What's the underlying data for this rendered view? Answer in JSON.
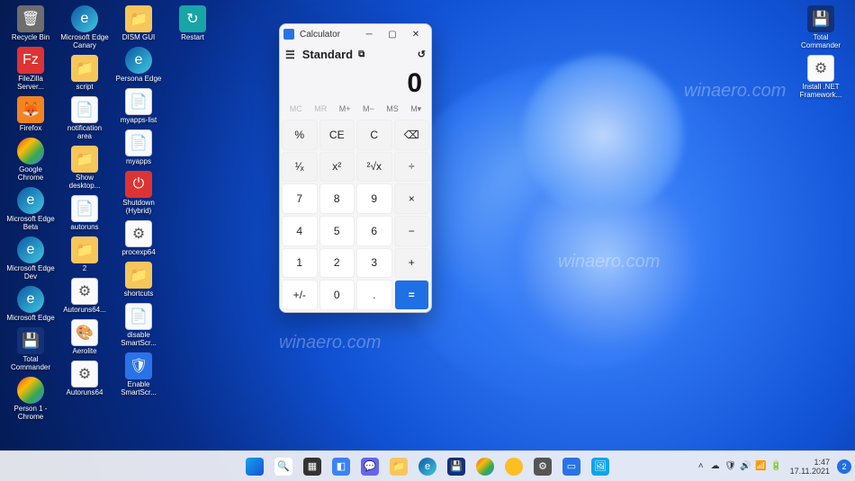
{
  "desktop_icons_left": [
    {
      "label": "Recycle Bin",
      "cls": "bin",
      "glyph": "🗑"
    },
    {
      "label": "FileZilla Server...",
      "cls": "red",
      "glyph": "Fz"
    },
    {
      "label": "Firefox",
      "cls": "orange",
      "glyph": "🦊"
    },
    {
      "label": "Google Chrome",
      "cls": "chrome",
      "glyph": ""
    },
    {
      "label": "Microsoft Edge Beta",
      "cls": "edge",
      "glyph": "e"
    },
    {
      "label": "Microsoft Edge Dev",
      "cls": "edge",
      "glyph": "e"
    },
    {
      "label": "Microsoft Edge",
      "cls": "edge",
      "glyph": "e"
    },
    {
      "label": "Total Commander",
      "cls": "navy",
      "glyph": "💾"
    },
    {
      "label": "Person 1 - Chrome",
      "cls": "chrome",
      "glyph": ""
    },
    {
      "label": "Microsoft Edge Canary",
      "cls": "edge",
      "glyph": "e"
    },
    {
      "label": "script",
      "cls": "folder",
      "glyph": "📁"
    },
    {
      "label": "notification area",
      "cls": "file",
      "glyph": "📄"
    },
    {
      "label": "Show desktop...",
      "cls": "folder",
      "glyph": "📁"
    },
    {
      "label": "autoruns",
      "cls": "file",
      "glyph": "📄"
    },
    {
      "label": "2",
      "cls": "folder",
      "glyph": "📁"
    },
    {
      "label": "Autoruns64...",
      "cls": "file",
      "glyph": "⚙"
    },
    {
      "label": "Aerolite",
      "cls": "file",
      "glyph": "🎨"
    },
    {
      "label": "Autoruns64",
      "cls": "file",
      "glyph": "⚙"
    },
    {
      "label": "DISM GUI",
      "cls": "folder",
      "glyph": "📁"
    },
    {
      "label": "Persona Edge",
      "cls": "edge",
      "glyph": "e"
    },
    {
      "label": "myapps-list",
      "cls": "file",
      "glyph": "📄"
    },
    {
      "label": "myapps",
      "cls": "file",
      "glyph": "📄"
    },
    {
      "label": "Shutdown (Hybrid)",
      "cls": "red",
      "glyph": "⏻"
    },
    {
      "label": "procexp64",
      "cls": "file",
      "glyph": "⚙"
    },
    {
      "label": "shortcuts",
      "cls": "folder",
      "glyph": "📁"
    },
    {
      "label": "disable SmartScr...",
      "cls": "file",
      "glyph": "📄"
    },
    {
      "label": "Enable SmartScr...",
      "cls": "blue",
      "glyph": "🛡"
    },
    {
      "label": "Restart",
      "cls": "teal",
      "glyph": "↻"
    }
  ],
  "desktop_icons_right": [
    {
      "label": "Total Commander",
      "cls": "navy",
      "glyph": "💾"
    },
    {
      "label": "Install .NET Framework...",
      "cls": "file",
      "glyph": "⚙"
    }
  ],
  "watermark": "winaero.com",
  "calc": {
    "title": "Calculator",
    "mode": "Standard",
    "display": "0",
    "memory": [
      "MC",
      "MR",
      "M+",
      "M−",
      "MS",
      "M▾"
    ],
    "keys": [
      {
        "t": "%",
        "c": "op"
      },
      {
        "t": "CE",
        "c": "op"
      },
      {
        "t": "C",
        "c": "op"
      },
      {
        "t": "⌫",
        "c": "op"
      },
      {
        "t": "¹⁄ₓ",
        "c": "op"
      },
      {
        "t": "x²",
        "c": "op"
      },
      {
        "t": "²√x",
        "c": "op"
      },
      {
        "t": "÷",
        "c": "op"
      },
      {
        "t": "7",
        "c": "num"
      },
      {
        "t": "8",
        "c": "num"
      },
      {
        "t": "9",
        "c": "num"
      },
      {
        "t": "×",
        "c": "op"
      },
      {
        "t": "4",
        "c": "num"
      },
      {
        "t": "5",
        "c": "num"
      },
      {
        "t": "6",
        "c": "num"
      },
      {
        "t": "−",
        "c": "op"
      },
      {
        "t": "1",
        "c": "num"
      },
      {
        "t": "2",
        "c": "num"
      },
      {
        "t": "3",
        "c": "num"
      },
      {
        "t": "+",
        "c": "op"
      },
      {
        "t": "+/-",
        "c": "num"
      },
      {
        "t": "0",
        "c": "num"
      },
      {
        "t": ".",
        "c": "num"
      },
      {
        "t": "=",
        "c": "eq"
      }
    ]
  },
  "taskbar_center": [
    {
      "name": "start",
      "bg": "linear-gradient(135deg,#0ea5e9,#1d4ed8)",
      "glyph": ""
    },
    {
      "name": "search",
      "bg": "#fff",
      "glyph": "🔍"
    },
    {
      "name": "taskview",
      "bg": "#333",
      "glyph": "▦"
    },
    {
      "name": "widgets",
      "bg": "#3b82f6",
      "glyph": "◧"
    },
    {
      "name": "chat",
      "bg": "#6366f1",
      "glyph": "💬"
    },
    {
      "name": "explorer",
      "bg": "#f7c65a",
      "glyph": "📁"
    },
    {
      "name": "edge",
      "bg": "linear-gradient(135deg,#0c59a4,#40c8e0)",
      "glyph": "e"
    },
    {
      "name": "commander",
      "bg": "#12317a",
      "glyph": "💾"
    },
    {
      "name": "chrome",
      "bg": "linear-gradient(135deg,#ea4335,#fbbc05,#34a853,#4285f4)",
      "glyph": ""
    },
    {
      "name": "chrome-canary",
      "bg": "#fbbf24",
      "glyph": ""
    },
    {
      "name": "settings",
      "bg": "#555",
      "glyph": "⚙"
    },
    {
      "name": "calculator",
      "bg": "#2973e6",
      "glyph": "▭"
    },
    {
      "name": "image",
      "bg": "#0ea5e9",
      "glyph": "🖼"
    }
  ],
  "tray": {
    "icons": [
      "☁",
      "🛡",
      "🔊",
      "📶",
      "🔋"
    ],
    "time": "1:47",
    "date": "17.11.2021",
    "notif": "2"
  }
}
